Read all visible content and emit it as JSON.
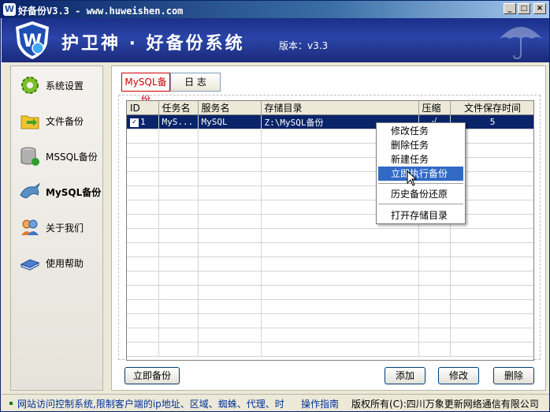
{
  "window": {
    "title": "好备份V3.3 - www.huweishen.com",
    "minimize": "_",
    "maximize": "□",
    "close": "×"
  },
  "header": {
    "brand": "护卫神 · 好备份系统",
    "version": "版本：v3.3"
  },
  "sidebar": {
    "items": [
      {
        "label": "系统设置",
        "icon": "gear-icon"
      },
      {
        "label": "文件备份",
        "icon": "folder-icon"
      },
      {
        "label": "MSSQL备份",
        "icon": "database-icon"
      },
      {
        "label": "MySQL备份",
        "icon": "dolphin-icon"
      },
      {
        "label": "关于我们",
        "icon": "users-icon"
      },
      {
        "label": "使用帮助",
        "icon": "book-icon"
      }
    ],
    "active_index": 3
  },
  "tabs": [
    {
      "label": "MySQL备份"
    },
    {
      "label": "日 志"
    }
  ],
  "grid": {
    "columns": [
      "ID",
      "任务名",
      "服务名",
      "存储目录",
      "压缩",
      "文件保存时间"
    ],
    "rows": [
      {
        "id": "1",
        "task": "MyS...",
        "service": "MySQL",
        "dir": "Z:\\MySQL备份",
        "compress": "√",
        "keep": "5",
        "checked": true
      }
    ]
  },
  "context_menu": {
    "items": [
      "修改任务",
      "删除任务",
      "新建任务",
      "立即执行备份",
      "历史备份还原",
      "打开存储目录"
    ],
    "highlighted_index": 3
  },
  "buttons": {
    "backup_now": "立即备份",
    "add": "添加",
    "edit": "修改",
    "delete": "删除"
  },
  "statusbar": {
    "marquee": "网站访问控制系统,限制客户端的ip地址、区域、蜘蛛、代理、时",
    "guide": "操作指南",
    "copyright": "版权所有(C):四川万象更新网络通信有限公司"
  },
  "colors": {
    "header_bg": "#1b2f8a",
    "selection": "#0a246a",
    "menu_highlight": "#316ac5",
    "active_tab": "#cc0000"
  }
}
